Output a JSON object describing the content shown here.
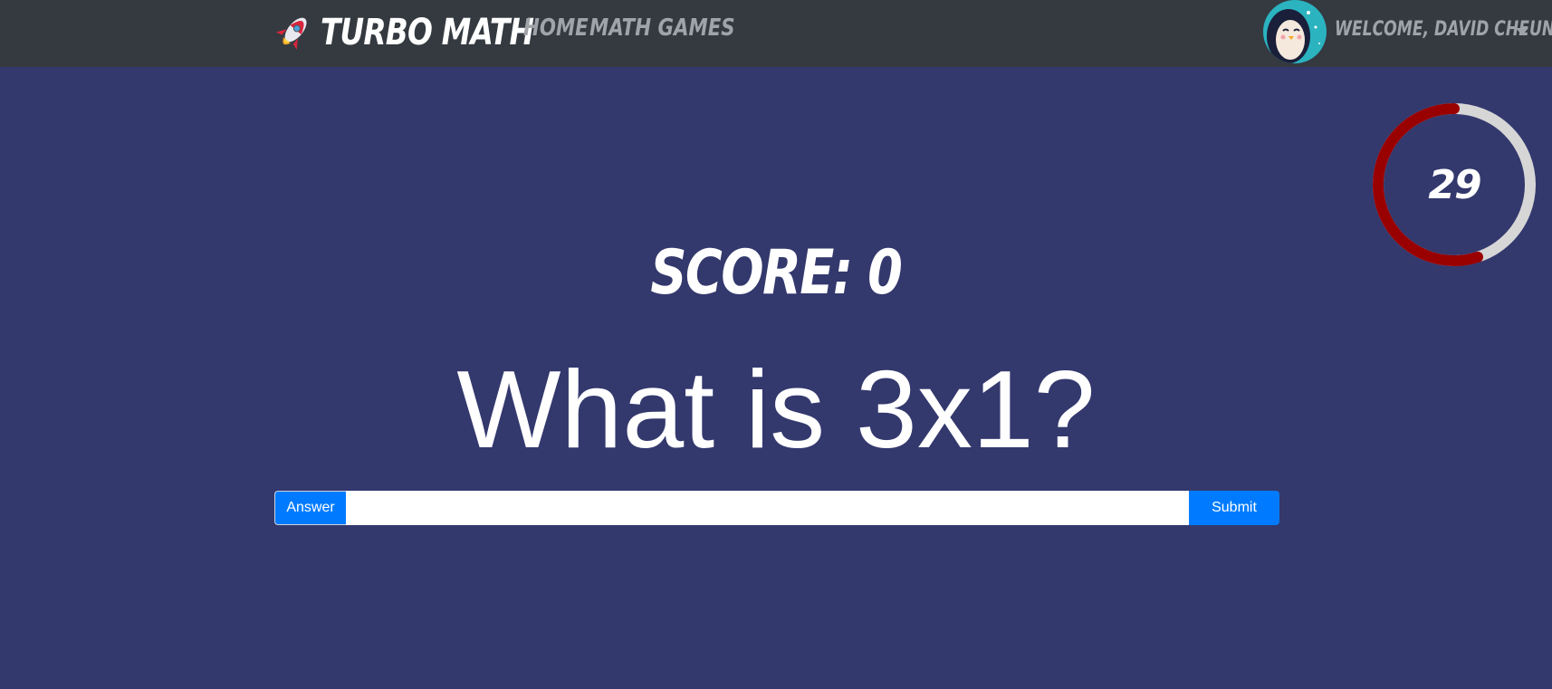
{
  "navbar": {
    "brand_label": "Turbo Math",
    "brand_icon": "rocket-icon",
    "links": [
      {
        "label": "Home"
      },
      {
        "label": "Math Games"
      }
    ],
    "user": {
      "avatar_icon": "penguin-avatar",
      "welcome_label": "Welcome, David Cheung",
      "dropdown_icon": "caret-down-icon"
    },
    "background": "#343a40"
  },
  "timer": {
    "seconds_left": "29",
    "progress_fraction": 0.55,
    "progress_color": "#990000",
    "track_color": "#d6d6d6"
  },
  "game": {
    "score_label": "Score: 0",
    "question": "What is 3x1?",
    "answer_prefix": "Answer",
    "answer_value": "",
    "submit_label": "Submit"
  },
  "colors": {
    "page_background": "#33386d",
    "primary": "#007bff"
  }
}
